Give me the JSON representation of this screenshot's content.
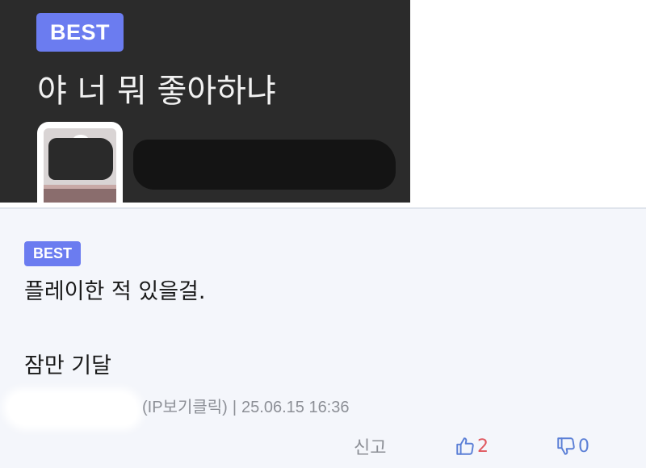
{
  "post": {
    "badge": "BEST",
    "title": "야 너 뭐 좋아하냐"
  },
  "comment": {
    "badge": "BEST",
    "text_line_1": "플레이한 적 있을걸.",
    "text_line_2": "잠만 기달",
    "ip_label": "(IP보기클릭)",
    "separator": "|",
    "timestamp": "25.06.15 16:36",
    "report_label": "신고",
    "like_count": "2",
    "dislike_count": "0"
  },
  "colors": {
    "badge": "#6b7cf0",
    "header_bg": "#2b2b2b",
    "comment_bg": "#f4f6fb",
    "like": "#e0585f",
    "dislike": "#5b7fd6",
    "meta": "#8c8f96"
  }
}
